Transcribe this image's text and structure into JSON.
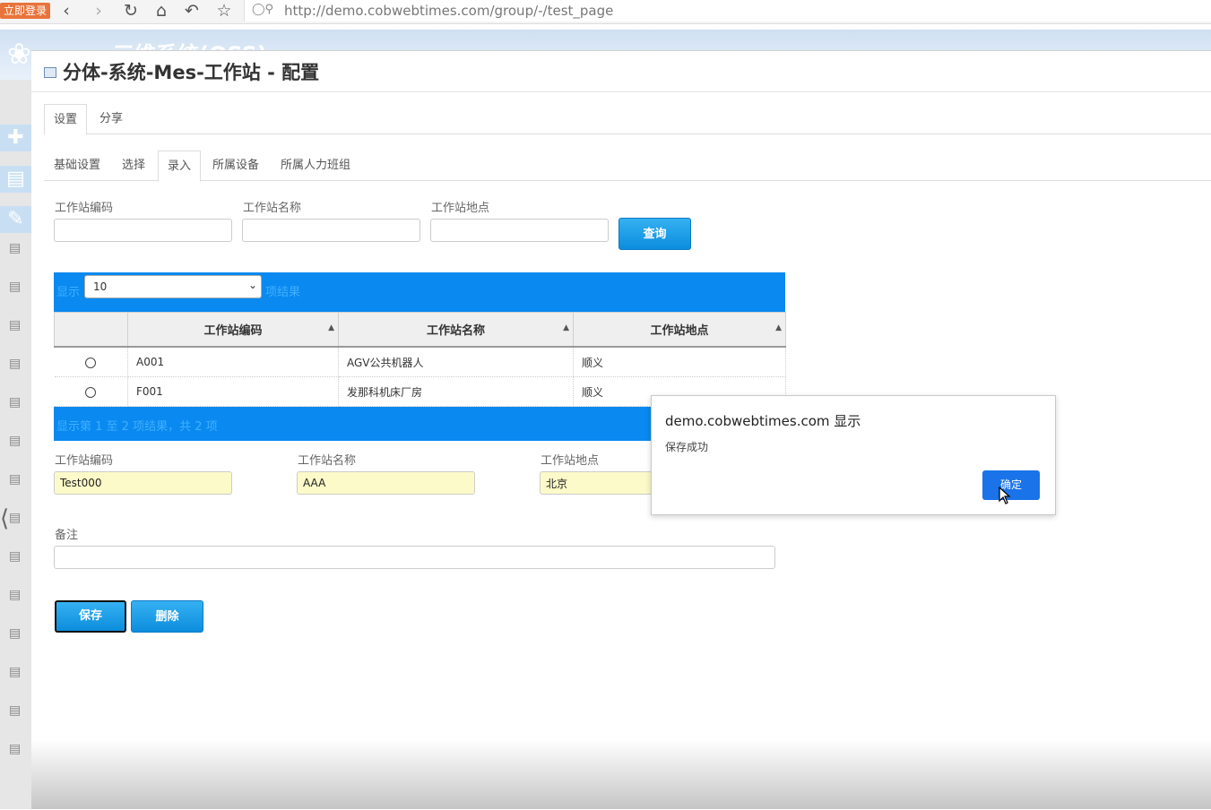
{
  "browser": {
    "login_badge": "立即登录",
    "url": "http://demo.cobwebtimes.com/group/-/test_page"
  },
  "app": {
    "title": "三维系统(OSS)"
  },
  "panel": {
    "title": "分体-系统-Mes-工作站 - 配置",
    "tabs": [
      {
        "label": "设置"
      },
      {
        "label": "分享"
      }
    ],
    "subtabs": [
      {
        "label": "基础设置"
      },
      {
        "label": "选择"
      },
      {
        "label": "录入"
      },
      {
        "label": "所属设备"
      },
      {
        "label": "所属人力班组"
      }
    ]
  },
  "search": {
    "code_label": "工作站编码",
    "name_label": "工作站名称",
    "location_label": "工作站地点",
    "code_value": "",
    "name_value": "",
    "location_value": "",
    "query_button": "查询"
  },
  "grid": {
    "show_label": "显示",
    "page_size": "10",
    "per_page_suffix": "项结果",
    "columns": [
      "工作站编码",
      "工作站名称",
      "工作站地点"
    ],
    "rows": [
      {
        "code": "A001",
        "name": "AGV公共机器人",
        "location": "顺义"
      },
      {
        "code": "F001",
        "name": "发那科机床厂房",
        "location": "顺义"
      }
    ],
    "info": "显示第 1 至 2 项结果，共 2 项"
  },
  "form": {
    "code_label": "工作站编码",
    "name_label": "工作站名称",
    "location_label": "工作站地点",
    "code_value": "Test000",
    "name_value": "AAA",
    "location_value": "北京",
    "remark_label": "备注",
    "remark_value": "",
    "save_button": "保存",
    "delete_button": "删除"
  },
  "dialog": {
    "title": "demo.cobwebtimes.com 显示",
    "message": "保存成功",
    "ok_button": "确定"
  },
  "colors": {
    "accent_blue": "#0a89f0",
    "button_blue": "#1a9fe8",
    "filled_input": "#fcfac8",
    "dialog_button": "#1a73e8"
  }
}
